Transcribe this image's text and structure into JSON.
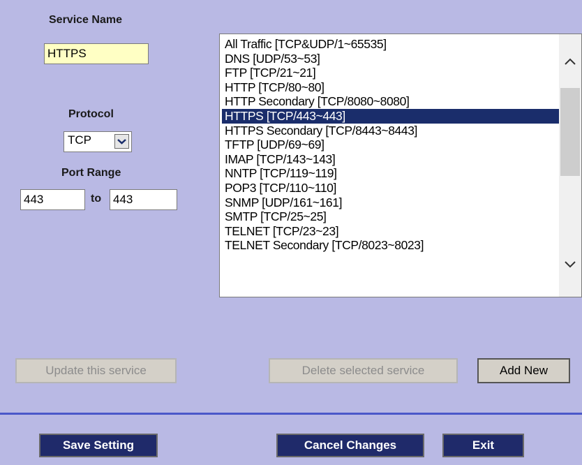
{
  "service_name": {
    "label": "Service Name",
    "value": "HTTPS"
  },
  "protocol": {
    "label": "Protocol",
    "selected": "TCP"
  },
  "port_range": {
    "label": "Port Range",
    "from": "443",
    "separator": "to",
    "to": "443"
  },
  "services": {
    "items": [
      "All Traffic [TCP&UDP/1~65535]",
      "DNS [UDP/53~53]",
      "FTP [TCP/21~21]",
      "HTTP [TCP/80~80]",
      "HTTP Secondary [TCP/8080~8080]",
      "HTTPS [TCP/443~443]",
      "HTTPS Secondary [TCP/8443~8443]",
      "TFTP [UDP/69~69]",
      "IMAP [TCP/143~143]",
      "NNTP [TCP/119~119]",
      "POP3 [TCP/110~110]",
      "SNMP [UDP/161~161]",
      "SMTP [TCP/25~25]",
      "TELNET [TCP/23~23]",
      "TELNET Secondary [TCP/8023~8023]"
    ],
    "selected_index": 5
  },
  "buttons": {
    "update": "Update this service",
    "delete": "Delete selected service",
    "add_new": "Add New",
    "save": "Save Setting",
    "cancel": "Cancel Changes",
    "exit": "Exit"
  },
  "colors": {
    "background": "#b9b9e4",
    "accent": "#1f2a6a",
    "selection": "#1a2d6b",
    "input_highlight": "#ffffc4"
  }
}
